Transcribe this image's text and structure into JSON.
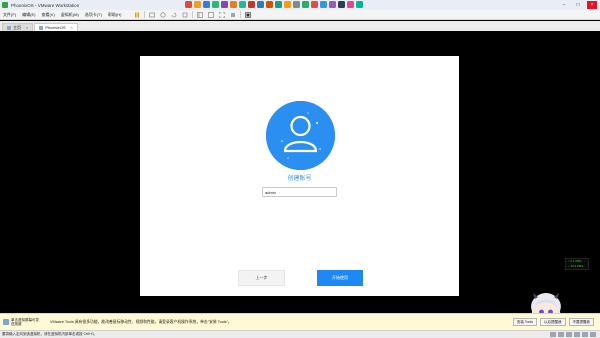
{
  "window": {
    "title": "PhoenixOS - VMware Workstation"
  },
  "menu": {
    "items": [
      "文件(F)",
      "编辑(E)",
      "查看(V)",
      "虚拟机(M)",
      "选项卡(T)",
      "帮助(H)"
    ]
  },
  "tabs": [
    {
      "label": "主页",
      "active": false
    },
    {
      "label": "PhoenixOS",
      "active": true
    }
  ],
  "vm": {
    "card_title": "创建账号",
    "username_value": "admin",
    "prev_label": "上一步",
    "start_label": "开始使用"
  },
  "net_speed": {
    "up": "↑ 0.1 KB/s",
    "down": "↓ 34.2 KB/s"
  },
  "notification": {
    "left_label": "单击虚拟屏幕可发送按键",
    "message": "VMware Tools 具有很多功能，能改善鼠标移动性、视频和性能。请登录客户机操作系统，单击\"安装 Tools\"。",
    "buttons": [
      "安装 Tools",
      "以后提醒我",
      "不要提醒我"
    ]
  },
  "statusbar": {
    "text": "要将输入定向到该虚拟机，请在虚拟机内部单击或按 Ctrl+G。"
  },
  "colors": {
    "accent_blue": "#1e88f5",
    "avatar_blue": "#2a8ff0"
  }
}
